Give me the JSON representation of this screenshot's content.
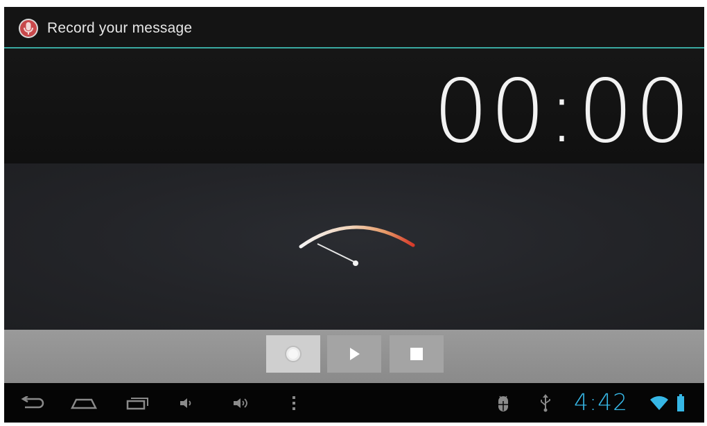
{
  "titlebar": {
    "title": "Record your message",
    "icon": "microphone-icon",
    "accent": "#39a9a1"
  },
  "recorder": {
    "elapsed": "00:00",
    "level_meter": {
      "level": 0.0,
      "arc_start_color": "#f2f2f2",
      "arc_end_color": "#d63a2a"
    }
  },
  "controls": {
    "record_icon": "record-icon",
    "play_icon": "play-icon",
    "stop_icon": "stop-icon",
    "selected": "record"
  },
  "navbar": {
    "back_icon": "back-icon",
    "home_icon": "home-icon",
    "recents_icon": "recent-apps-icon",
    "volume_down_icon": "volume-down-icon",
    "volume_up_icon": "volume-up-icon",
    "menu_icon": "menu-icon",
    "debug_icon": "android-debug-icon",
    "usb_icon": "usb-icon",
    "time": "4:42",
    "wifi_icon": "wifi-icon",
    "battery_icon": "battery-icon",
    "clock_color": "#36b7e6"
  }
}
